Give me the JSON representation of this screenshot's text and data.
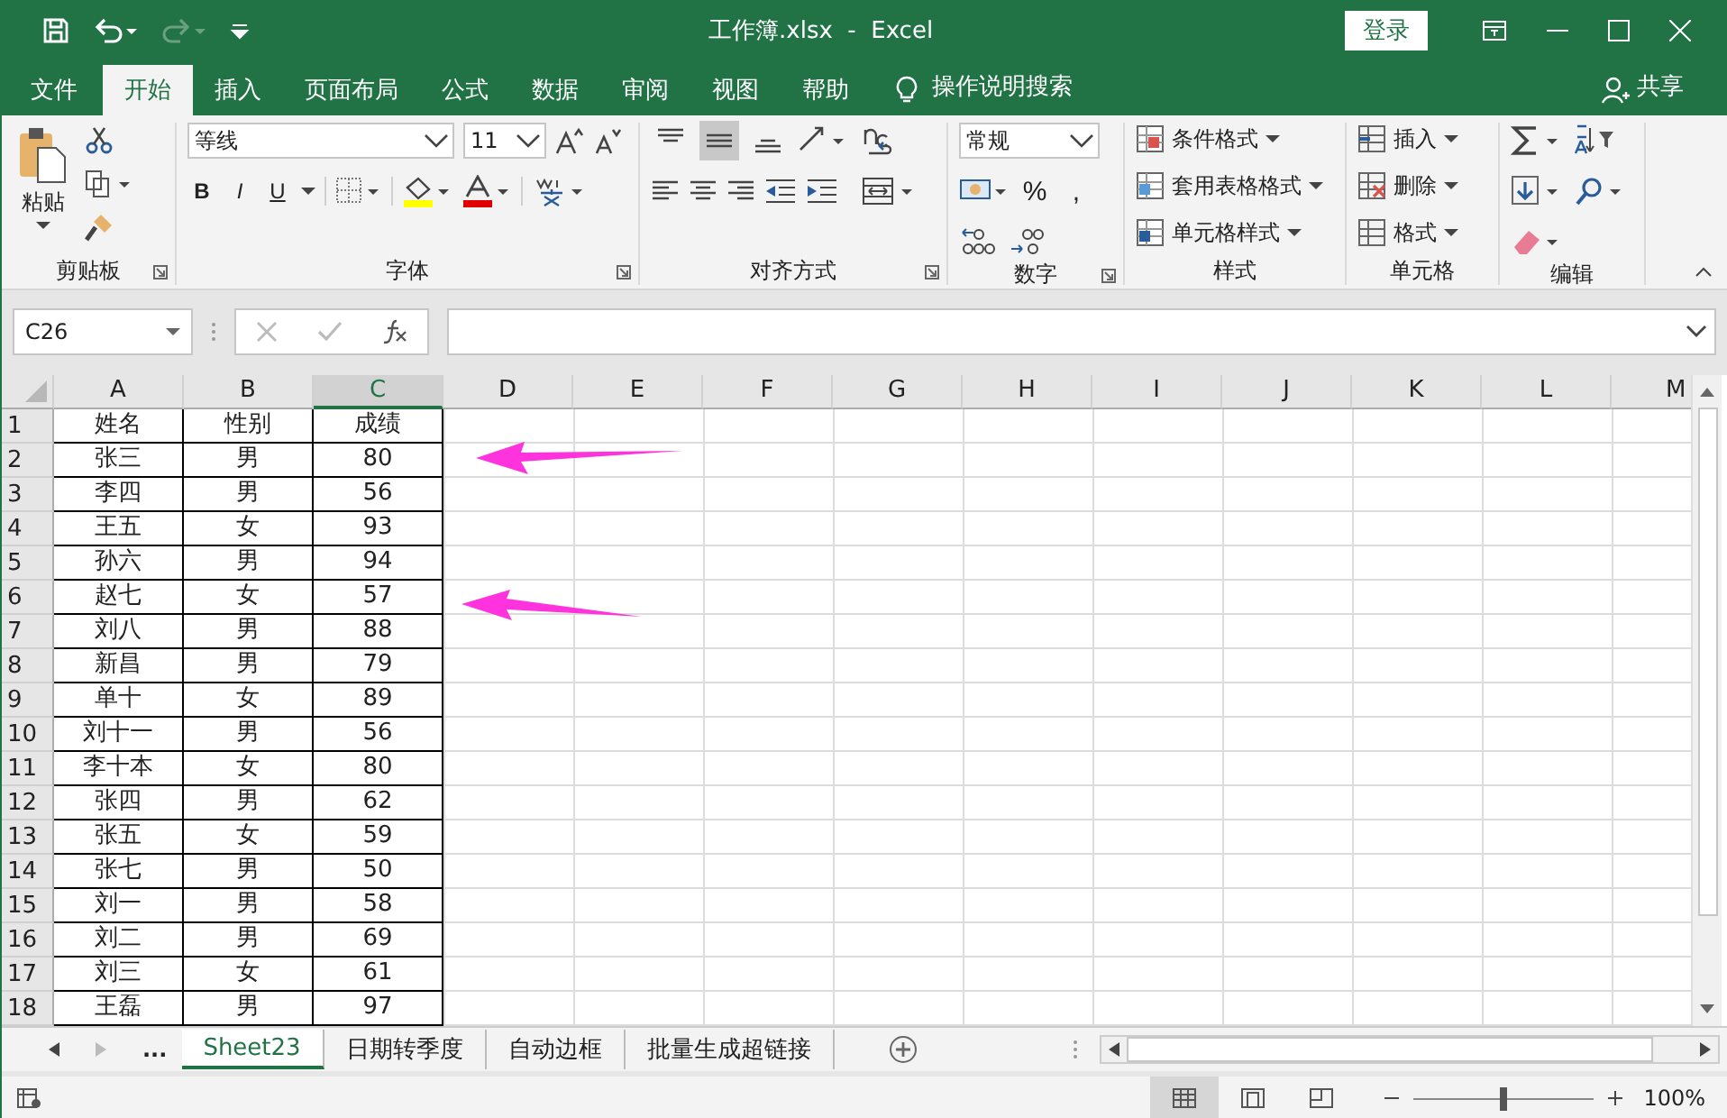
{
  "title_bar": {
    "title": "工作簿.xlsx  -  Excel",
    "login_button": "登录"
  },
  "menu_tabs": [
    {
      "label": "文件",
      "selected": false
    },
    {
      "label": "开始",
      "selected": true
    },
    {
      "label": "插入",
      "selected": false
    },
    {
      "label": "页面布局",
      "selected": false
    },
    {
      "label": "公式",
      "selected": false
    },
    {
      "label": "数据",
      "selected": false
    },
    {
      "label": "审阅",
      "selected": false
    },
    {
      "label": "视图",
      "selected": false
    },
    {
      "label": "帮助",
      "selected": false
    }
  ],
  "tell_me": "操作说明搜索",
  "share": "共享",
  "ribbon_groups": [
    {
      "kind": "clipboard",
      "label": "剪贴板",
      "launcher": true,
      "paste": "粘贴"
    },
    {
      "kind": "font",
      "label": "字体",
      "launcher": true,
      "font_name": "等线",
      "font_size": "11",
      "bold": "B",
      "italic": "I",
      "underline": "U"
    },
    {
      "kind": "alignment",
      "label": "对齐方式",
      "launcher": true,
      "vertical_align": [
        {
          "selected": false
        },
        {
          "selected": true
        },
        {
          "selected": false
        }
      ]
    },
    {
      "kind": "number",
      "label": "数字",
      "launcher": true,
      "format": "常规",
      "percent": "%",
      "comma": ","
    },
    {
      "kind": "styles",
      "label": "样式",
      "launcher": false,
      "items": [
        "条件格式",
        "套用表格格式",
        "单元格样式"
      ]
    },
    {
      "kind": "cells",
      "label": "单元格",
      "launcher": false,
      "items": [
        "插入",
        "删除",
        "格式"
      ]
    },
    {
      "kind": "editing",
      "label": "编辑",
      "launcher": false
    }
  ],
  "formula_bar": {
    "name_box": "C26"
  },
  "sheet": {
    "columns": [
      {
        "label": "A",
        "selected": false
      },
      {
        "label": "B",
        "selected": false
      },
      {
        "label": "C",
        "selected": true
      },
      {
        "label": "D",
        "selected": false
      },
      {
        "label": "E",
        "selected": false
      },
      {
        "label": "F",
        "selected": false
      },
      {
        "label": "G",
        "selected": false
      },
      {
        "label": "H",
        "selected": false
      },
      {
        "label": "I",
        "selected": false
      },
      {
        "label": "J",
        "selected": false
      },
      {
        "label": "K",
        "selected": false
      },
      {
        "label": "L",
        "selected": false
      },
      {
        "label": "M",
        "selected": false
      }
    ],
    "rows": [
      {
        "number": "1",
        "cells": [
          "姓名",
          "性别",
          "成绩"
        ]
      },
      {
        "number": "2",
        "cells": [
          "张三",
          "男",
          "80"
        ]
      },
      {
        "number": "3",
        "cells": [
          "李四",
          "男",
          "56"
        ]
      },
      {
        "number": "4",
        "cells": [
          "王五",
          "女",
          "93"
        ]
      },
      {
        "number": "5",
        "cells": [
          "孙六",
          "男",
          "94"
        ]
      },
      {
        "number": "6",
        "cells": [
          "赵七",
          "女",
          "57"
        ]
      },
      {
        "number": "7",
        "cells": [
          "刘八",
          "男",
          "88"
        ]
      },
      {
        "number": "8",
        "cells": [
          "新昌",
          "男",
          "79"
        ]
      },
      {
        "number": "9",
        "cells": [
          "单十",
          "女",
          "89"
        ]
      },
      {
        "number": "10",
        "cells": [
          "刘十一",
          "男",
          "56"
        ]
      },
      {
        "number": "11",
        "cells": [
          "李十本",
          "女",
          "80"
        ]
      },
      {
        "number": "12",
        "cells": [
          "张四",
          "男",
          "62"
        ]
      },
      {
        "number": "13",
        "cells": [
          "张五",
          "女",
          "59"
        ]
      },
      {
        "number": "14",
        "cells": [
          "张七",
          "男",
          "50"
        ]
      },
      {
        "number": "15",
        "cells": [
          "刘一",
          "男",
          "58"
        ]
      },
      {
        "number": "16",
        "cells": [
          "刘二",
          "男",
          "69"
        ]
      },
      {
        "number": "17",
        "cells": [
          "刘三",
          "女",
          "61"
        ]
      },
      {
        "number": "18",
        "cells": [
          "王磊",
          "男",
          "97"
        ]
      }
    ]
  },
  "sheet_tabs": {
    "more": "...",
    "tabs": [
      {
        "label": "Sheet23",
        "selected": true
      },
      {
        "label": "日期转季度",
        "selected": false
      },
      {
        "label": "自动边框",
        "selected": false
      },
      {
        "label": "批量生成超链接",
        "selected": false
      }
    ]
  },
  "status_bar": {
    "views": [
      {
        "selected": true
      },
      {
        "selected": false
      },
      {
        "selected": false
      }
    ],
    "zoom": {
      "level": 0.5
    },
    "zoom_label": "100%"
  }
}
